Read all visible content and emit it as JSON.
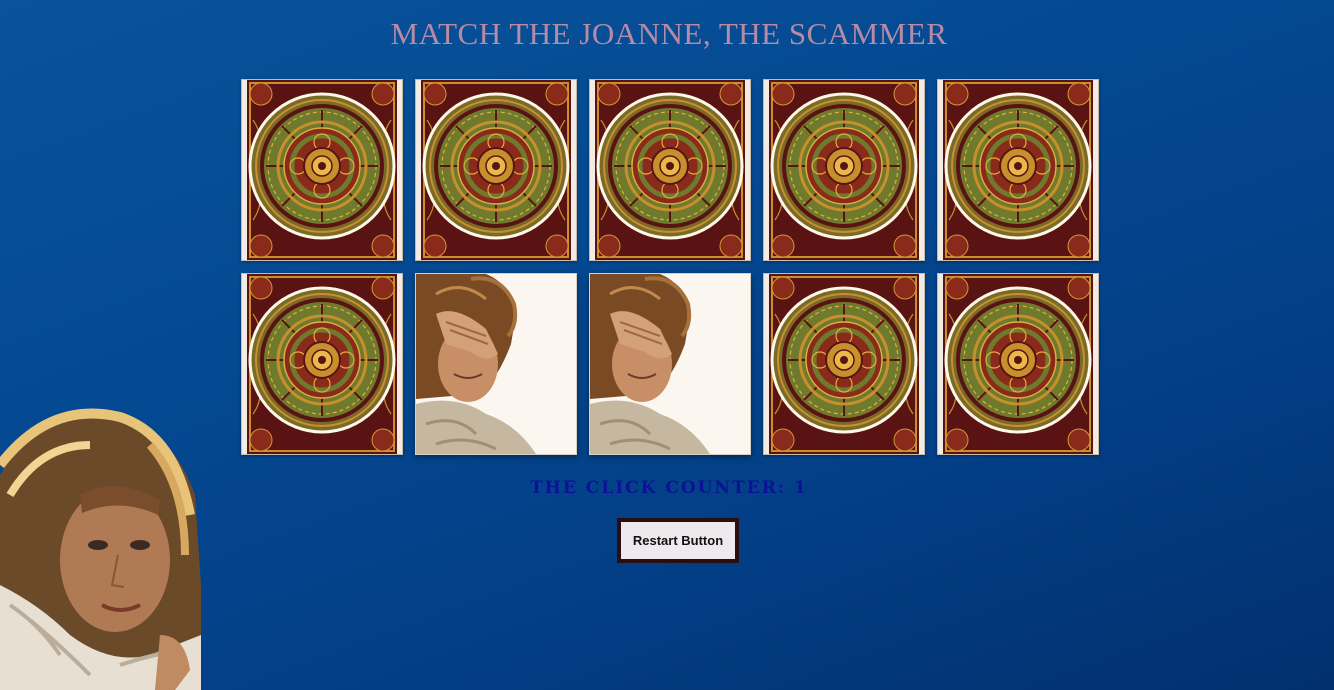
{
  "page": {
    "title": "MATCH THE JOANNE, THE SCAMMER"
  },
  "game": {
    "cards": [
      {
        "state": "face-down",
        "image": "tarot-card-back"
      },
      {
        "state": "face-down",
        "image": "tarot-card-back"
      },
      {
        "state": "face-down",
        "image": "tarot-card-back"
      },
      {
        "state": "face-down",
        "image": "tarot-card-back"
      },
      {
        "state": "face-down",
        "image": "tarot-card-back"
      },
      {
        "state": "face-down",
        "image": "tarot-card-back"
      },
      {
        "state": "face-up",
        "image": "man-holding-head"
      },
      {
        "state": "face-up",
        "image": "man-holding-head"
      },
      {
        "state": "face-down",
        "image": "tarot-card-back"
      },
      {
        "state": "face-down",
        "image": "tarot-card-back"
      }
    ]
  },
  "counter": {
    "label": "THE CLICK COUNTER: 1"
  },
  "controls": {
    "restart_label": "Restart Button"
  },
  "colors": {
    "background": "#044a93",
    "title": "#b78aa6",
    "counter": "#0d1197",
    "card_back_maroon": "#5a1313",
    "card_back_gold": "#c8902c",
    "card_back_olive": "#6f7a2c"
  }
}
